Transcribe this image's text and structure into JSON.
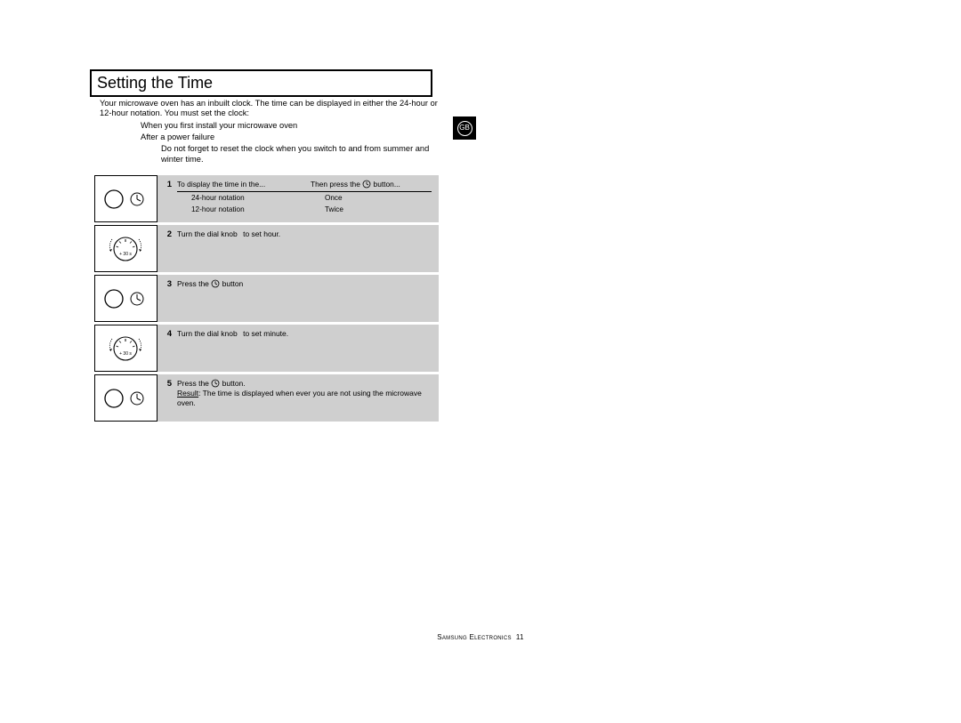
{
  "title": "Setting the Time",
  "country_badge": "GB",
  "intro": {
    "line1": "Your microwave oven has an inbuilt clock. The time can be displayed in either the 24-hour or 12-hour notation. You must set the clock:",
    "bullet1": "When you first install your microwave oven",
    "bullet2": "After a power failure",
    "note": "Do not forget to reset the clock when you switch to and from summer and winter time."
  },
  "steps": {
    "s1": {
      "num": "1",
      "head_left": "To display the time in the...",
      "head_mid": "Then press the ",
      "head_right": "button...",
      "row1_left": "24-hour notation",
      "row1_right": "Once",
      "row2_left": "12-hour notation",
      "row2_right": "Twice"
    },
    "s2": {
      "num": "2",
      "text_a": "Turn the dial knob",
      "text_b": "to set hour."
    },
    "s3": {
      "num": "3",
      "text_a": "Press the ",
      "text_b": " button"
    },
    "s4": {
      "num": "4",
      "text_a": "Turn the dial knob",
      "text_b": "to set minute."
    },
    "s5": {
      "num": "5",
      "text_a": "Press the ",
      "text_b": " button.",
      "result_label": "Result",
      "result_text": ": The time is displayed when ever you are not using the microwave oven."
    }
  },
  "footer": {
    "company_caps": "Samsung Electronics",
    "pagenum": "11"
  }
}
